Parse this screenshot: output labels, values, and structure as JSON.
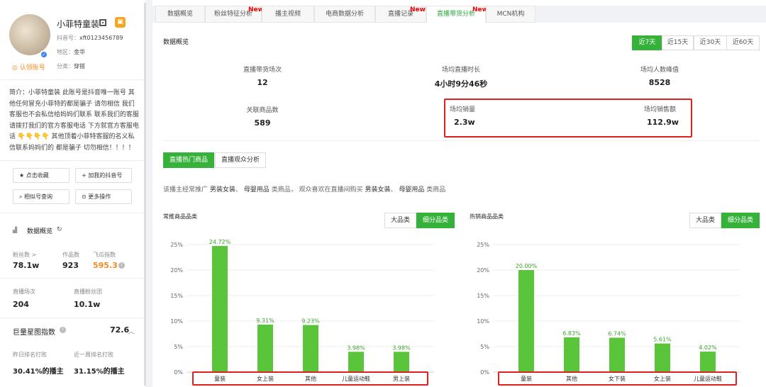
{
  "profile": {
    "name": "小菲特童装",
    "douyin_id_label": "抖音号：",
    "douyin_id": "xft0123456789",
    "region_label": "地区：",
    "region": "金华",
    "category_label": "分类：",
    "category": "穿搭",
    "claim": "认领账号",
    "intro": "简介：小菲特童装 此账号是抖音唯一账号 其他任何冒充小菲特的都是骗子 请勿相信 我们客服也不会私信给妈妈们联系 联系我们的客服请拨打我们的官方客服电话 下方就官方客服电话 👇👇👇👇 其他顶着小菲特客服的名义私信联系妈妈们的 都是骗子 切勿相信！！！！"
  },
  "actions": {
    "collect": "点击收藏",
    "add": "加我的抖音号",
    "similar": "相似号查询",
    "more": "更多操作"
  },
  "overview": {
    "title": "数据概览",
    "fans_label": "粉丝数 >",
    "fans": "78.1w",
    "works_label": "作品数",
    "works": "923",
    "flygua_label": "飞瓜指数",
    "flygua": "595.3",
    "live_count_label": "直播场次",
    "live_count": "204",
    "live_fans_label": "直播粉丝团",
    "live_fans": "10.1w",
    "juliang_label": "巨量星图指数",
    "juliang": "72.6",
    "rank_yesterday_label": "昨日排名打败",
    "rank_yesterday": "30.41%的播主",
    "rank_week_label": "近一周排名打败",
    "rank_week": "31.15%的播主"
  },
  "tabs": [
    {
      "label": "数据概览",
      "new": ""
    },
    {
      "label": "粉丝特征分析",
      "new": "New"
    },
    {
      "label": "播主视频",
      "new": ""
    },
    {
      "label": "电商数据分析",
      "new": ""
    },
    {
      "label": "直播记录",
      "new": "New"
    },
    {
      "label": "直播带货分析",
      "new": "New"
    },
    {
      "label": "MCN机构",
      "new": ""
    }
  ],
  "data_overview": {
    "title": "数据概览",
    "ranges": [
      "近7天",
      "近15天",
      "近30天",
      "近60天"
    ],
    "stats": {
      "live_sessions_label": "直播带货场次",
      "live_sessions": "12",
      "avg_duration_label": "场均直播时长",
      "avg_duration": "4小时9分46秒",
      "avg_peak_label": "场均人数峰值",
      "avg_peak": "8528",
      "linked_goods_label": "关联商品数",
      "linked_goods": "589",
      "avg_sales_label": "场均销量",
      "avg_sales": "2.3w",
      "avg_revenue_label": "场均销售额",
      "avg_revenue": "112.9w"
    }
  },
  "goods_tabs": [
    "直播热门商品",
    "直播观众分析"
  ],
  "description": {
    "prefix": "该播主经常推广",
    "cat1": "男装女装",
    "sep1": "、",
    "cat2": "母婴用品",
    "mid": "类商品， 观众喜欢在直播间购买",
    "cat3": "男装女装",
    "sep2": "、",
    "cat4": "母婴用品",
    "suffix": "类商品"
  },
  "chart_buttons": [
    "大品类",
    "细分品类"
  ],
  "colors": {
    "accent": "#36b23b",
    "bar": "#5ac53a",
    "highlight": "#e02020",
    "new": "#e00000"
  },
  "chart_data": [
    {
      "type": "bar",
      "title": "常推商品品类",
      "categories": [
        "童装",
        "女上装",
        "其他",
        "儿童运动鞋",
        "男上装"
      ],
      "values": [
        24.72,
        9.31,
        9.23,
        3.98,
        3.98
      ],
      "labels": [
        "24.72%",
        "9.31%",
        "9.23%",
        "3.98%",
        "3.98%"
      ],
      "yticks": [
        "25%",
        "20%",
        "15%",
        "10%",
        "5%",
        "0%"
      ],
      "ylim": [
        0,
        25
      ]
    },
    {
      "type": "bar",
      "title": "热销商品品类",
      "categories": [
        "童装",
        "其他",
        "女下装",
        "女上装",
        "儿童运动鞋"
      ],
      "values": [
        20.0,
        6.83,
        6.74,
        5.61,
        4.02
      ],
      "labels": [
        "20.00%",
        "6.83%",
        "6.74%",
        "5.61%",
        "4.02%"
      ],
      "yticks": [
        "25%",
        "20%",
        "15%",
        "10%",
        "5%",
        "0%"
      ],
      "ylim": [
        0,
        25
      ]
    }
  ]
}
